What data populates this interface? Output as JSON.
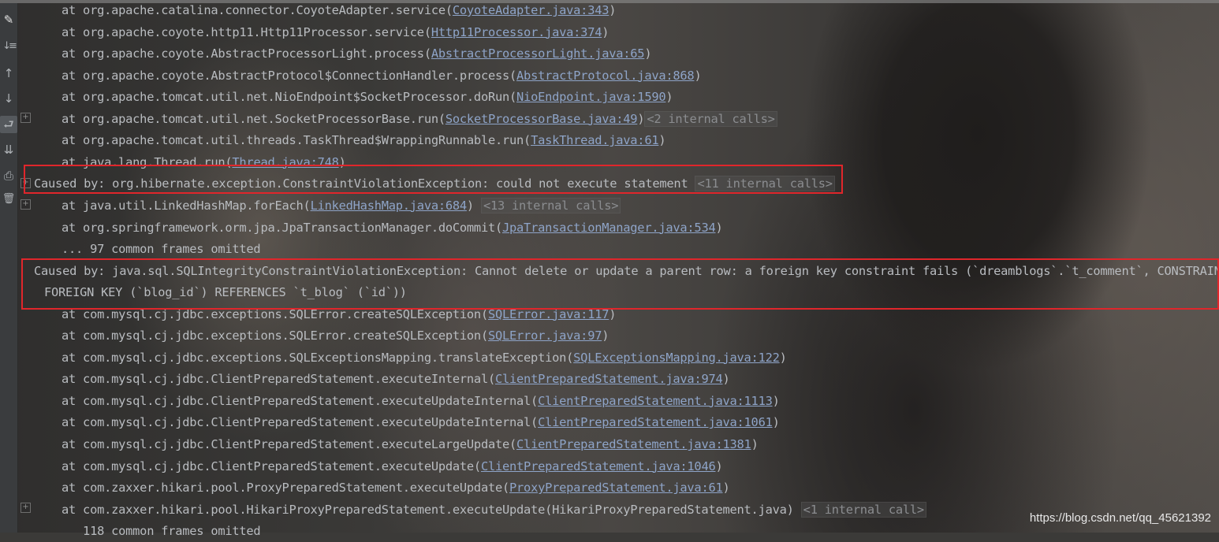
{
  "toolbar": {
    "tools": [
      {
        "icon": "✎",
        "name": "pencil-icon"
      },
      {
        "icon": "↓≡",
        "name": "sort-icon"
      },
      {
        "icon": "↑",
        "name": "up-arrow-icon"
      },
      {
        "icon": "↓",
        "name": "down-arrow-icon"
      },
      {
        "icon": "⮐",
        "name": "soft-wrap-icon"
      },
      {
        "icon": "⇊",
        "name": "scroll-to-end-icon"
      },
      {
        "icon": "⎙",
        "name": "print-icon"
      },
      {
        "icon": "🗑",
        "name": "trash-icon"
      }
    ]
  },
  "lines": [
    {
      "prefix": "at org.apache.catalina.connector.CoyoteAdapter.service(",
      "link": "CoyoteAdapter.java:343",
      "suffix": ")",
      "internal": "",
      "indent": "1"
    },
    {
      "prefix": "at org.apache.coyote.http11.Http11Processor.service(",
      "link": "Http11Processor.java:374",
      "suffix": ")",
      "internal": "",
      "indent": "1"
    },
    {
      "prefix": "at org.apache.coyote.AbstractProcessorLight.process(",
      "link": "AbstractProcessorLight.java:65",
      "suffix": ")",
      "internal": "",
      "indent": "1"
    },
    {
      "prefix": "at org.apache.coyote.AbstractProtocol$ConnectionHandler.process(",
      "link": "AbstractProtocol.java:868",
      "suffix": ")",
      "internal": "",
      "indent": "1"
    },
    {
      "prefix": "at org.apache.tomcat.util.net.NioEndpoint$SocketProcessor.doRun(",
      "link": "NioEndpoint.java:1590",
      "suffix": ")",
      "internal": "",
      "indent": "1"
    },
    {
      "prefix": "at org.apache.tomcat.util.net.SocketProcessorBase.run(",
      "link": "SocketProcessorBase.java:49",
      "suffix": ")",
      "internal": "<2 internal calls>",
      "indent": "1"
    },
    {
      "prefix": "at org.apache.tomcat.util.threads.TaskThread$WrappingRunnable.run(",
      "link": "TaskThread.java:61",
      "suffix": ")",
      "internal": "",
      "indent": "1"
    },
    {
      "prefix": "at java.lang.Thread.run(",
      "link": "Thread.java:748",
      "suffix": ")",
      "internal": "",
      "indent": "1"
    },
    {
      "prefix": "Caused by: org.hibernate.exception.ConstraintViolationException: could not execute statement ",
      "link": "",
      "suffix": "",
      "internal": "<11 internal calls>",
      "indent": "0"
    },
    {
      "prefix": "at java.util.LinkedHashMap.forEach(",
      "link": "LinkedHashMap.java:684",
      "suffix": ") ",
      "internal": "<13 internal calls>",
      "indent": "1"
    },
    {
      "prefix": "at org.springframework.orm.jpa.JpaTransactionManager.doCommit(",
      "link": "JpaTransactionManager.java:534",
      "suffix": ")",
      "internal": "",
      "indent": "1"
    },
    {
      "prefix": "... 97 common frames omitted",
      "link": "",
      "suffix": "",
      "internal": "",
      "indent": "1"
    },
    {
      "prefix": "Caused by: java.sql.SQLIntegrityConstraintViolationException: Cannot delete or update a parent row: a foreign key constraint fails (`dreamblogs`.`t_comment`, CONSTRAIN",
      "link": "",
      "suffix": "",
      "internal": "",
      "indent": "0"
    },
    {
      "prefix": "FOREIGN KEY (`blog_id`) REFERENCES `t_blog` (`id`))",
      "link": "",
      "suffix": "",
      "internal": "",
      "indent": "2"
    },
    {
      "prefix": "at com.mysql.cj.jdbc.exceptions.SQLError.createSQLException(",
      "link": "SQLError.java:117",
      "suffix": ")",
      "internal": "",
      "indent": "1"
    },
    {
      "prefix": "at com.mysql.cj.jdbc.exceptions.SQLError.createSQLException(",
      "link": "SQLError.java:97",
      "suffix": ")",
      "internal": "",
      "indent": "1"
    },
    {
      "prefix": "at com.mysql.cj.jdbc.exceptions.SQLExceptionsMapping.translateException(",
      "link": "SQLExceptionsMapping.java:122",
      "suffix": ")",
      "internal": "",
      "indent": "1"
    },
    {
      "prefix": "at com.mysql.cj.jdbc.ClientPreparedStatement.executeInternal(",
      "link": "ClientPreparedStatement.java:974",
      "suffix": ")",
      "internal": "",
      "indent": "1"
    },
    {
      "prefix": "at com.mysql.cj.jdbc.ClientPreparedStatement.executeUpdateInternal(",
      "link": "ClientPreparedStatement.java:1113",
      "suffix": ")",
      "internal": "",
      "indent": "1"
    },
    {
      "prefix": "at com.mysql.cj.jdbc.ClientPreparedStatement.executeUpdateInternal(",
      "link": "ClientPreparedStatement.java:1061",
      "suffix": ")",
      "internal": "",
      "indent": "1"
    },
    {
      "prefix": "at com.mysql.cj.jdbc.ClientPreparedStatement.executeLargeUpdate(",
      "link": "ClientPreparedStatement.java:1381",
      "suffix": ")",
      "internal": "",
      "indent": "1"
    },
    {
      "prefix": "at com.mysql.cj.jdbc.ClientPreparedStatement.executeUpdate(",
      "link": "ClientPreparedStatement.java:1046",
      "suffix": ")",
      "internal": "",
      "indent": "1"
    },
    {
      "prefix": "at com.zaxxer.hikari.pool.ProxyPreparedStatement.executeUpdate(",
      "link": "ProxyPreparedStatement.java:61",
      "suffix": ")",
      "internal": "",
      "indent": "1"
    },
    {
      "prefix": "at com.zaxxer.hikari.pool.HikariProxyPreparedStatement.executeUpdate(HikariProxyPreparedStatement.java) ",
      "link": "",
      "suffix": "",
      "internal": "<1 internal call>",
      "indent": "1"
    },
    {
      "prefix": "   118 common frames omitted",
      "link": "",
      "suffix": "",
      "internal": "",
      "indent": "1"
    }
  ],
  "watermark": "https://blog.csdn.net/qq_45621392",
  "colors": {
    "highlight_box": "#e0262b",
    "link": "#8ea4c8",
    "text": "#b9bcc0"
  }
}
